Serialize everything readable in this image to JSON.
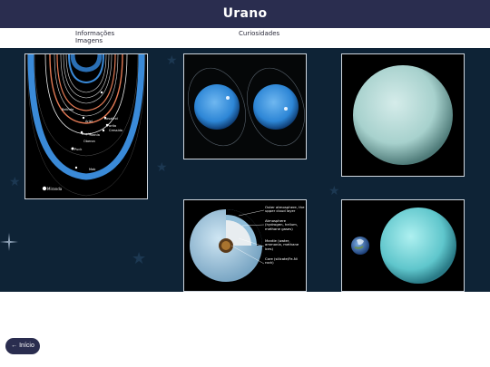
{
  "header": {
    "title": "Urano"
  },
  "nav": {
    "info": "Informações",
    "images": "Imagens",
    "curiosities": "Curiosidades"
  },
  "colors": {
    "header_bg": "#2a2d4f",
    "stage_bg": "#0e2336",
    "accent_blue": "#3b88d8"
  },
  "gallery": {
    "rings_labels": [
      "Rosalind",
      "Portia",
      "Cressida",
      "Titania",
      "Oberon",
      "Miranda",
      "Ariel",
      "Puck",
      "Cupid",
      "Belinda",
      "Mab"
    ],
    "rings_moon_miranda": "Miranda",
    "interior_labels": {
      "outer": "Outer atmosphere, the upper cloud layer",
      "atmosphere": "Atmosphere (hydrogen, helium, methane gases)",
      "mantle": "Mantle (water, ammonia, methane ices)",
      "core": "Core (silicate/Fe-Ni rock)"
    }
  },
  "footer": {
    "back_label": "← Início"
  }
}
